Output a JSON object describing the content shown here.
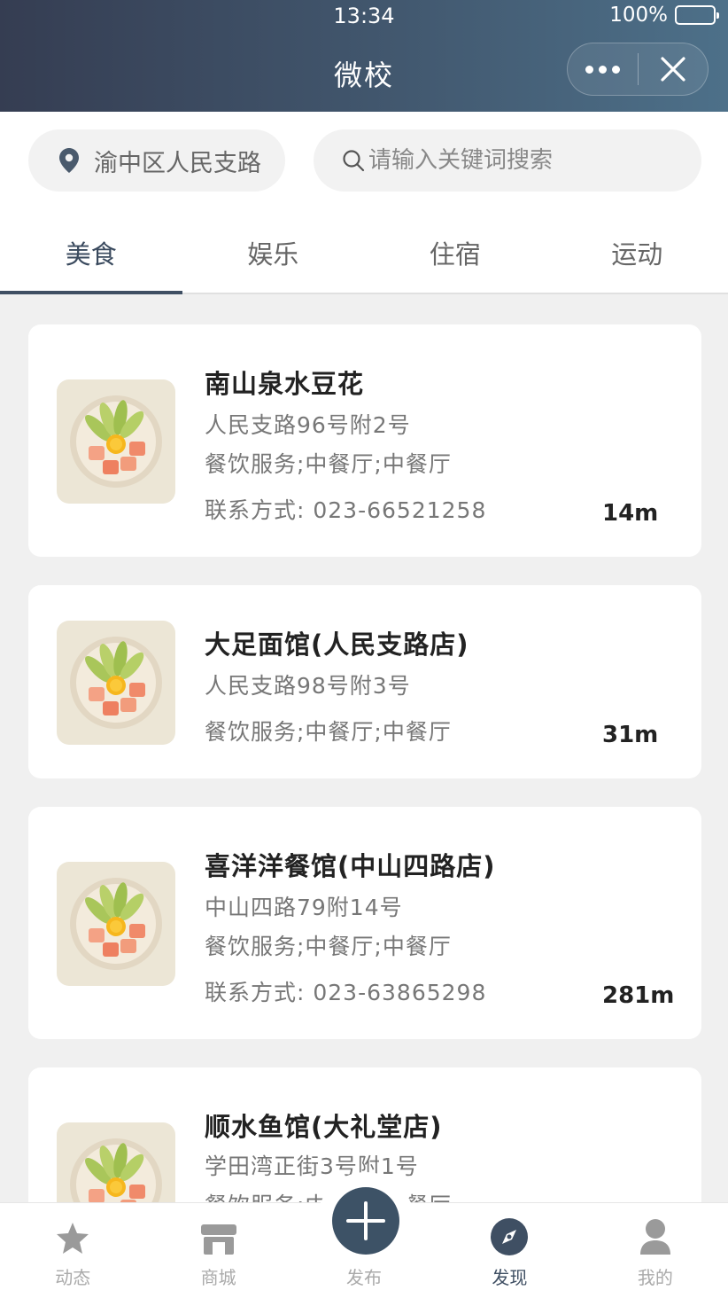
{
  "status_bar": {
    "time": "13:34",
    "battery": "100%"
  },
  "nav": {
    "title": "微校"
  },
  "search": {
    "location": "渝中区人民支路",
    "placeholder": "请输入关键词搜索"
  },
  "tabs": [
    {
      "label": "美食",
      "active": true
    },
    {
      "label": "娱乐",
      "active": false
    },
    {
      "label": "住宿",
      "active": false
    },
    {
      "label": "运动",
      "active": false
    }
  ],
  "places": [
    {
      "name": "南山泉水豆花",
      "address": "人民支路96号附2号",
      "category": "餐饮服务;中餐厅;中餐厅",
      "contact": "联系方式: 023-66521258",
      "distance": "14m"
    },
    {
      "name": "大足面馆(人民支路店)",
      "address": "人民支路98号附3号",
      "category": "餐饮服务;中餐厅;中餐厅",
      "distance": "31m"
    },
    {
      "name": "喜洋洋餐馆(中山四路店)",
      "address": "中山四路79附14号",
      "category": "餐饮服务;中餐厅;中餐厅",
      "contact": "联系方式: 023-63865298",
      "distance": "281m"
    },
    {
      "name": "顺水鱼馆(大礼堂店)",
      "address": "学田湾正街3号附1号",
      "category": "餐饮服务;中餐厅;中餐厅"
    }
  ],
  "bottom_nav": [
    {
      "label": "动态",
      "icon": "star-icon"
    },
    {
      "label": "商城",
      "icon": "store-icon"
    },
    {
      "label": "发布",
      "icon": "plus-icon"
    },
    {
      "label": "发现",
      "icon": "compass-icon",
      "active": true
    },
    {
      "label": "我的",
      "icon": "user-icon"
    }
  ],
  "colors": {
    "header_start": "#353d52",
    "header_end": "#4d7089",
    "accent": "#3f4f63"
  }
}
